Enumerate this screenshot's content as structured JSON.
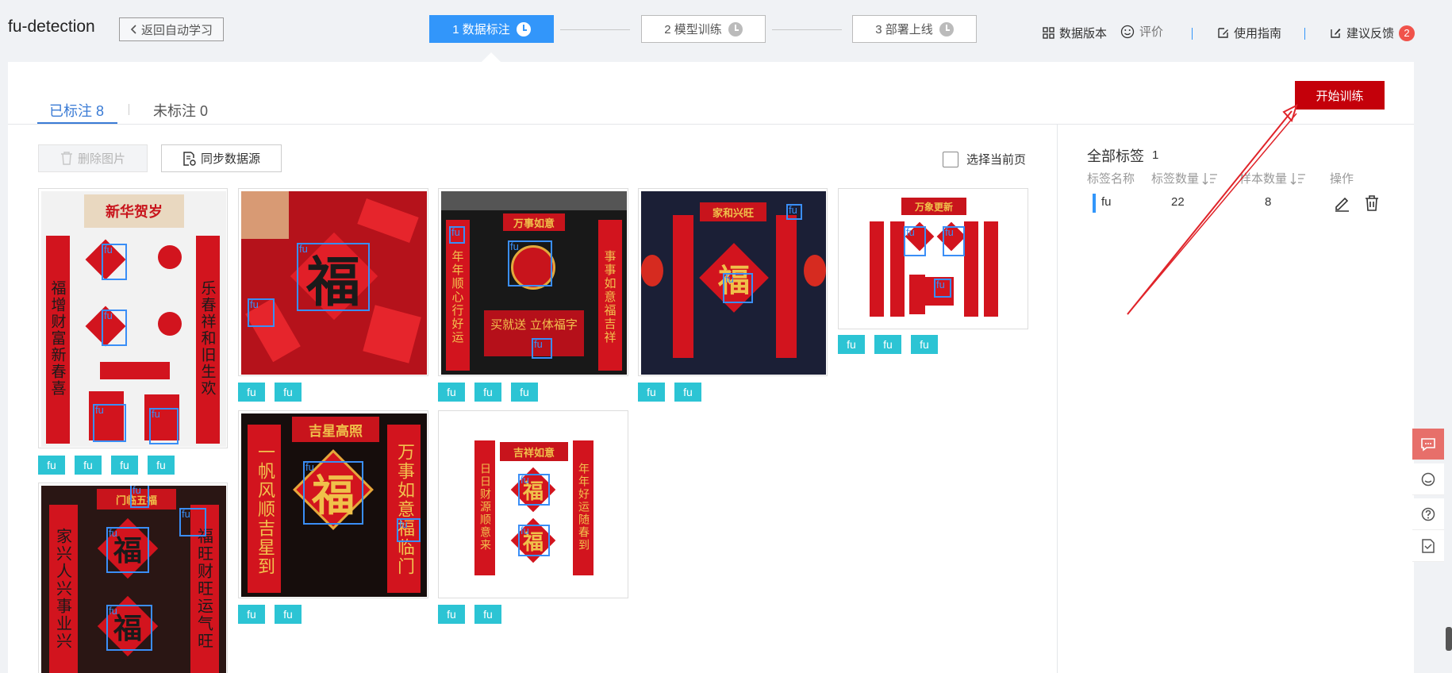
{
  "app_title": "fu-detection",
  "back_button": "返回自动学习",
  "steps": [
    {
      "label": "1 数据标注",
      "active": true
    },
    {
      "label": "2 模型训练",
      "active": false
    },
    {
      "label": "3 部署上线",
      "active": false
    }
  ],
  "top_links": {
    "data_version": "数据版本",
    "rating": "评价",
    "guide": "使用指南",
    "feedback": "建议反馈",
    "feedback_badge": "2"
  },
  "start_training": "开始训练",
  "tabs": [
    {
      "label": "已标注 8",
      "active": true
    },
    {
      "label": "未标注 0",
      "active": false
    }
  ],
  "toolbar": {
    "delete": "删除图片",
    "sync": "同步数据源",
    "select_page": "选择当前页"
  },
  "images": [
    {
      "tags": [
        "fu",
        "fu",
        "fu",
        "fu"
      ],
      "bbox_label": "fu",
      "texts": {
        "banner": "新华贺岁",
        "left": "福增财富新春喜",
        "right": "乐春祥和旧生欢"
      }
    },
    {
      "tags": [
        "fu",
        "fu"
      ],
      "bbox_label": "fu",
      "texts": {
        "glyph": "福"
      }
    },
    {
      "tags": [
        "fu",
        "fu",
        "fu"
      ],
      "bbox_label": "fu",
      "texts": {
        "banner": "万事如意",
        "left": "年年顺心行好运",
        "right": "事事如意福吉祥",
        "bottom": "买就送 立体福字"
      }
    },
    {
      "tags": [
        "fu",
        "fu"
      ],
      "bbox_label": "fu",
      "texts": {
        "banner": "家和兴旺",
        "glyph": "福"
      }
    },
    {
      "tags": [
        "fu",
        "fu",
        "fu"
      ],
      "bbox_label": "fu",
      "texts": {
        "banner": "万象更新"
      }
    },
    {
      "tags": [],
      "bbox_label": "fu",
      "texts": {
        "banner": "门临五福",
        "left": "家兴人兴事业兴",
        "right": "福旺财旺运气旺",
        "glyph": "福"
      }
    },
    {
      "tags": [
        "fu",
        "fu"
      ],
      "bbox_label": "fu",
      "texts": {
        "banner": "吉星高照",
        "left": "一帆风顺吉星到",
        "right": "万事如意福临门",
        "glyph": "福"
      }
    },
    {
      "tags": [
        "fu",
        "fu"
      ],
      "bbox_label": "fu",
      "texts": {
        "banner": "吉祥如意",
        "left": "日日财源顺意来",
        "right": "年年好运随春到",
        "glyph": "福"
      }
    }
  ],
  "labels_panel": {
    "title": "全部标签",
    "count": "1",
    "headers": {
      "name": "标签名称",
      "label_count": "标签数量",
      "sample_count": "样本数量",
      "action": "操作"
    },
    "rows": [
      {
        "name": "fu",
        "label_count": "22",
        "sample_count": "8"
      }
    ]
  },
  "colors": {
    "primary": "#3296fa",
    "train_button": "#c4000a",
    "tag": "#2cc4d4",
    "annotation_arrow": "#e0242a",
    "badge": "#f0534b"
  }
}
